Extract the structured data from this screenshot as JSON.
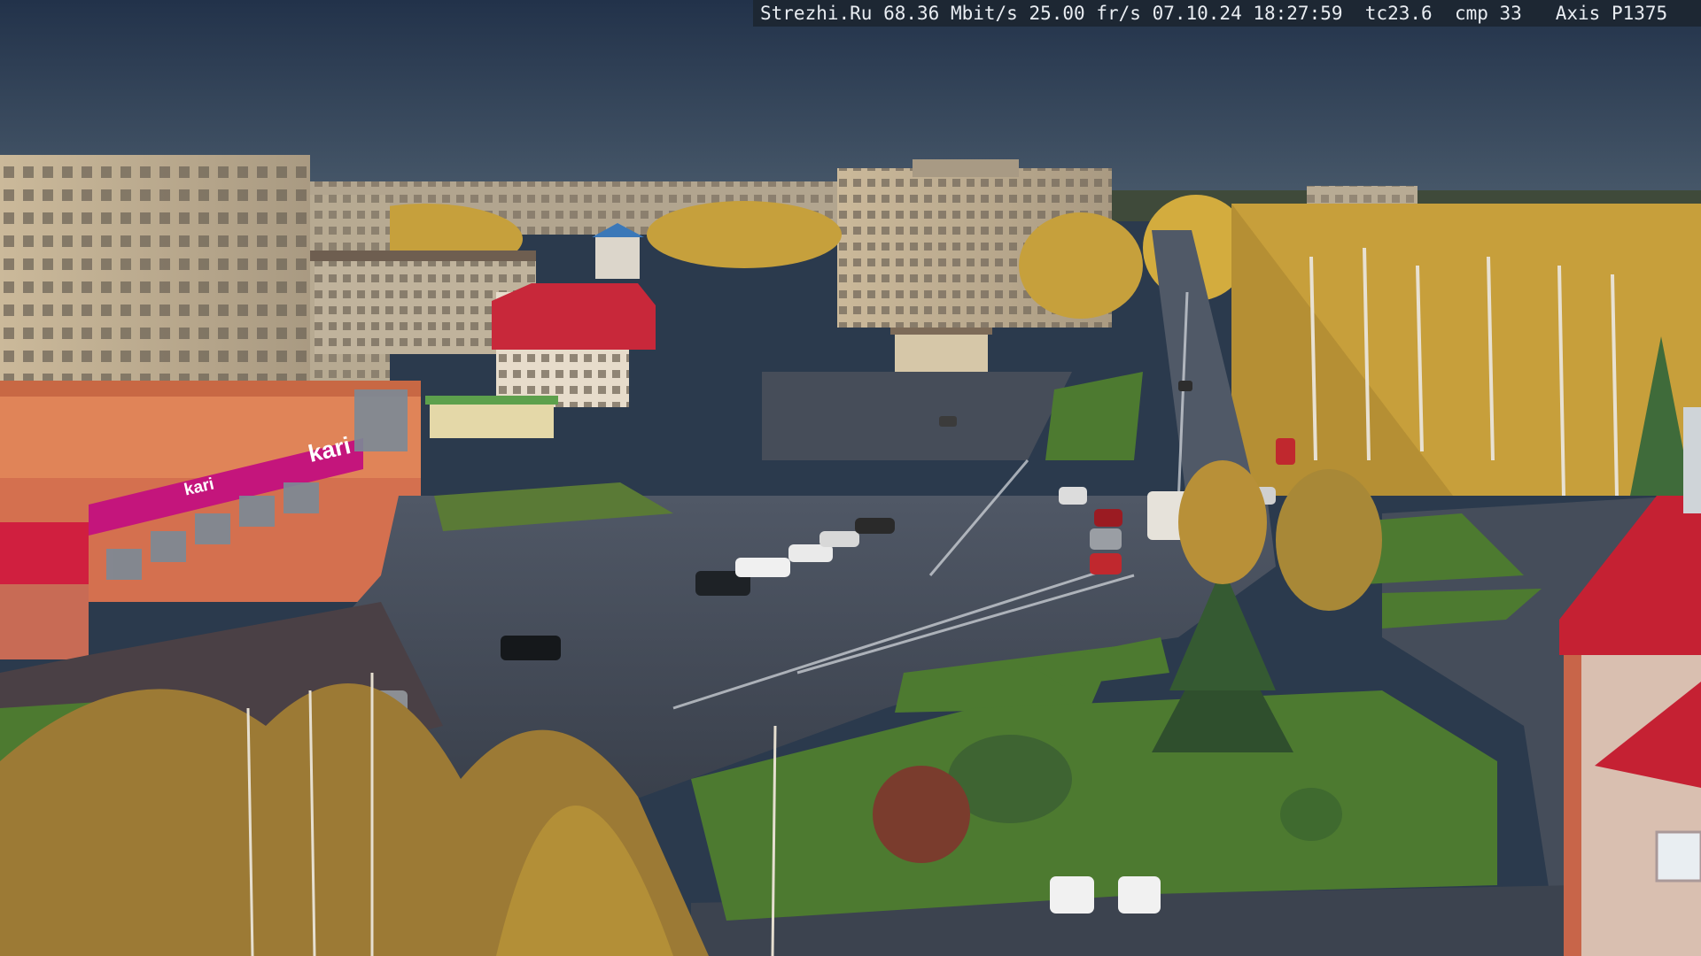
{
  "camera_overlay": {
    "site": "Strezhi.Ru",
    "bitrate": "68.36 Mbit/s",
    "framerate": "25.00 fr/s",
    "datetime": "07.10.24 18:27:59",
    "tc": "tc23.6",
    "cmp": "cmp 33",
    "camera_model": "Axis P1375"
  },
  "storefront": {
    "logo_text": "kari",
    "banner_small": "kari"
  },
  "palette": {
    "sky_top": "#27384b",
    "sky_low": "#46586c",
    "road": "#3b4350",
    "grass": "#4f7a33",
    "foliage": "#c8a23a",
    "panel_building": "#b9a98f",
    "kari_magenta": "#c4157c"
  }
}
